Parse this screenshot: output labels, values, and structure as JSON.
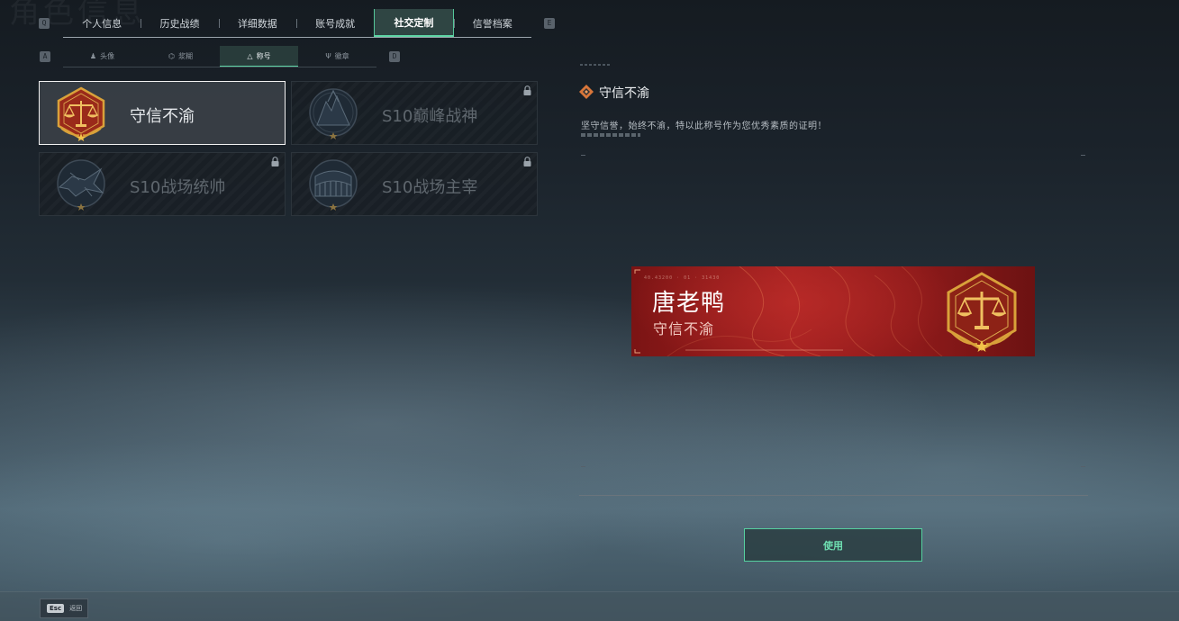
{
  "header": {
    "bg_title": "角色信息",
    "prev_key": "Q",
    "next_key": "E",
    "tabs": [
      {
        "label": "个人信息",
        "active": false
      },
      {
        "label": "历史战绩",
        "active": false
      },
      {
        "label": "详细数据",
        "active": false
      },
      {
        "label": "账号成就",
        "active": false
      },
      {
        "label": "社交定制",
        "active": true
      },
      {
        "label": "信誉档案",
        "active": false
      }
    ]
  },
  "subnav": {
    "prev_key": "A",
    "next_key": "D",
    "tabs": [
      {
        "label": "头像",
        "icon": "person-icon",
        "active": false
      },
      {
        "label": "浆糊",
        "icon": "frame-icon",
        "active": false
      },
      {
        "label": "称号",
        "icon": "title-icon",
        "active": true
      },
      {
        "label": "徽章",
        "icon": "emblem-icon",
        "active": false
      }
    ]
  },
  "titles": [
    {
      "name": "守信不渝",
      "badge": "scales-badge",
      "locked": false,
      "selected": true
    },
    {
      "name": "S10巅峰战神",
      "badge": "peak-warrior-badge",
      "locked": true,
      "selected": false
    },
    {
      "name": "S10战场统帅",
      "badge": "commander-badge",
      "locked": true,
      "selected": false
    },
    {
      "name": "S10战场主宰",
      "badge": "colosseum-badge",
      "locked": true,
      "selected": false
    }
  ],
  "detail": {
    "title": "守信不渝",
    "description": "坚守信誉，始终不渝，特以此称号作为您优秀素质的证明！"
  },
  "nameplate": {
    "player_name": "唐老鸭",
    "title": "守信不渝",
    "code": "40.43200 · 01 · 31430"
  },
  "actions": {
    "use_label": "使用"
  },
  "footer": {
    "back_key": "Esc",
    "back_label": "返回"
  },
  "colors": {
    "accent": "#5fd6a6",
    "plate_red": "#a32020",
    "badge_gold": "#d9a13a",
    "badge_red": "#9a2a1a"
  }
}
